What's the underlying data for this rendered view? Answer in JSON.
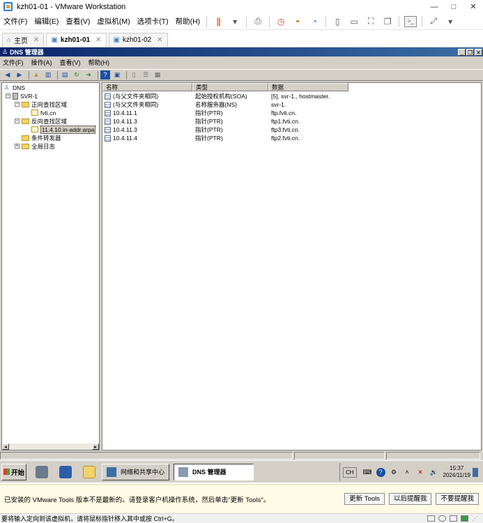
{
  "vmware": {
    "title": "kzh01-01 - VMware Workstation",
    "window_controls": [
      "—",
      "□",
      "✕"
    ],
    "menu": [
      "文件(F)",
      "编辑(E)",
      "查看(V)",
      "虚拟机(M)",
      "选项卡(T)",
      "帮助(H)"
    ],
    "tabs": [
      {
        "label": "主页",
        "icon": "home-icon"
      },
      {
        "label": "kzh01-01",
        "icon": "vm-icon",
        "active": true
      },
      {
        "label": "kzh01-02",
        "icon": "vm-icon"
      }
    ],
    "tab_close": "✕"
  },
  "dns": {
    "title": "DNS 管理器",
    "window_controls": [
      "_",
      "❐",
      "✕"
    ],
    "menu": [
      "文件(F)",
      "操作(A)",
      "查看(V)",
      "帮助(H)"
    ],
    "tree": {
      "root": "DNS",
      "server": "SVR-1",
      "forward_zones": "正向查找区域",
      "forward_zone_1": "fvti.cn",
      "reverse_zones": "反向查找区域",
      "reverse_zone_1": "11.4.10.in-addr.arpa",
      "conditional_forwarders": "条件转发器",
      "global_logs": "全局日志"
    },
    "list": {
      "columns": [
        "名称",
        "类型",
        "数据"
      ],
      "rows": [
        {
          "name": "(与父文件夹相同)",
          "type": "起始授权机构(SOA)",
          "data": "[5], svr-1., hostmaster."
        },
        {
          "name": "(与父文件夹相同)",
          "type": "名称服务器(NS)",
          "data": "svr-1."
        },
        {
          "name": "10.4.11.1",
          "type": "指针(PTR)",
          "data": "ftp.fvti.cn."
        },
        {
          "name": "10.4.11.3",
          "type": "指针(PTR)",
          "data": "ftp1.fvti.cn."
        },
        {
          "name": "10.4.11.3",
          "type": "指针(PTR)",
          "data": "ftp3.fvti.cn."
        },
        {
          "name": "10.4.11.4",
          "type": "指针(PTR)",
          "data": "ftp2.fvti.cn."
        }
      ]
    }
  },
  "taskbar": {
    "start": "开始",
    "tasks": [
      {
        "label": "网络和共享中心",
        "active": false
      },
      {
        "label": "DNS 管理器",
        "active": true
      }
    ],
    "tray_lang": "CH",
    "clock_time": "15:37",
    "clock_date": "2024/11/19"
  },
  "notification": {
    "message": "已安装的 VMware Tools 版本不是最新的。请登录客户机操作系统，然后单击\"更新 Tools\"。",
    "buttons": [
      "更新 Tools",
      "以后提醒我",
      "不要提醒我"
    ]
  },
  "status": {
    "message": "要将输入定向到该虚拟机，请将鼠标指针移入其中或按 Ctrl+G。"
  }
}
